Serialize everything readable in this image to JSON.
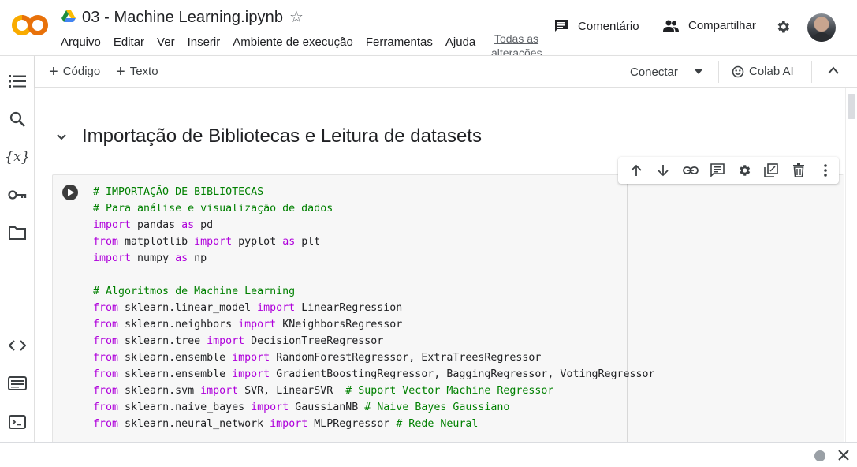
{
  "header": {
    "logo_text": "CO",
    "notebook_title": "03 - Machine Learning.ipynb",
    "menu": [
      "Arquivo",
      "Editar",
      "Ver",
      "Inserir",
      "Ambiente de execução",
      "Ferramentas",
      "Ajuda"
    ],
    "changes_link": "Todas as alterações",
    "comment_label": "Comentário",
    "share_label": "Compartilhar"
  },
  "toolbar": {
    "add_code_label": "Código",
    "add_text_label": "Texto",
    "connect_label": "Conectar",
    "colab_ai_label": "Colab AI"
  },
  "section": {
    "title": "Importação de Bibliotecas e Leitura de datasets"
  },
  "cell": {
    "code_lines": [
      [
        {
          "t": "# IMPORTAÇÃO DE BIBLIOTECAS",
          "c": "cm"
        }
      ],
      [
        {
          "t": "# Para análise e visualização de dados",
          "c": "cm"
        }
      ],
      [
        {
          "t": "import",
          "c": "kw"
        },
        {
          "t": " pandas ",
          "c": ""
        },
        {
          "t": "as",
          "c": "kw"
        },
        {
          "t": " pd",
          "c": ""
        }
      ],
      [
        {
          "t": "from",
          "c": "kw"
        },
        {
          "t": " matplotlib ",
          "c": ""
        },
        {
          "t": "import",
          "c": "kw"
        },
        {
          "t": " pyplot ",
          "c": ""
        },
        {
          "t": "as",
          "c": "kw"
        },
        {
          "t": " plt",
          "c": ""
        }
      ],
      [
        {
          "t": "import",
          "c": "kw"
        },
        {
          "t": " numpy ",
          "c": ""
        },
        {
          "t": "as",
          "c": "kw"
        },
        {
          "t": " np",
          "c": ""
        }
      ],
      [],
      [
        {
          "t": "# Algoritmos de Machine Learning",
          "c": "cm"
        }
      ],
      [
        {
          "t": "from",
          "c": "kw"
        },
        {
          "t": " sklearn.linear_model ",
          "c": ""
        },
        {
          "t": "import",
          "c": "kw"
        },
        {
          "t": " LinearRegression",
          "c": ""
        }
      ],
      [
        {
          "t": "from",
          "c": "kw"
        },
        {
          "t": " sklearn.neighbors ",
          "c": ""
        },
        {
          "t": "import",
          "c": "kw"
        },
        {
          "t": " KNeighborsRegressor",
          "c": ""
        }
      ],
      [
        {
          "t": "from",
          "c": "kw"
        },
        {
          "t": " sklearn.tree ",
          "c": ""
        },
        {
          "t": "import",
          "c": "kw"
        },
        {
          "t": " DecisionTreeRegressor",
          "c": ""
        }
      ],
      [
        {
          "t": "from",
          "c": "kw"
        },
        {
          "t": " sklearn.ensemble ",
          "c": ""
        },
        {
          "t": "import",
          "c": "kw"
        },
        {
          "t": " RandomForestRegressor, ExtraTreesRegressor",
          "c": ""
        }
      ],
      [
        {
          "t": "from",
          "c": "kw"
        },
        {
          "t": " sklearn.ensemble ",
          "c": ""
        },
        {
          "t": "import",
          "c": "kw"
        },
        {
          "t": " GradientBoostingRegressor, BaggingRegressor, VotingRegressor",
          "c": ""
        }
      ],
      [
        {
          "t": "from",
          "c": "kw"
        },
        {
          "t": " sklearn.svm ",
          "c": ""
        },
        {
          "t": "import",
          "c": "kw"
        },
        {
          "t": " SVR, LinearSVR  ",
          "c": ""
        },
        {
          "t": "# Suport Vector Machine Regressor",
          "c": "cm"
        }
      ],
      [
        {
          "t": "from",
          "c": "kw"
        },
        {
          "t": " sklearn.naive_bayes ",
          "c": ""
        },
        {
          "t": "import",
          "c": "kw"
        },
        {
          "t": " GaussianNB ",
          "c": ""
        },
        {
          "t": "# Naive Bayes Gaussiano",
          "c": "cm"
        }
      ],
      [
        {
          "t": "from",
          "c": "kw"
        },
        {
          "t": " sklearn.neural_network ",
          "c": ""
        },
        {
          "t": "import",
          "c": "kw"
        },
        {
          "t": " MLPRegressor ",
          "c": ""
        },
        {
          "t": "# Rede Neural",
          "c": "cm"
        }
      ]
    ]
  },
  "cell_toolbar_icons": [
    "arrow-up-icon",
    "arrow-down-icon",
    "link-icon",
    "comment-icon",
    "gear-icon",
    "mirror-cell-icon",
    "delete-icon",
    "more-vert-icon"
  ],
  "rail_icons": [
    "table-of-contents-icon",
    "search-icon",
    "variables-icon",
    "key-icon",
    "folder-icon",
    "code-snippets-icon",
    "command-palette-icon",
    "terminal-icon"
  ],
  "colors": {
    "accent_orange": "#f9ab00",
    "accent_orange_dark": "#e8710a",
    "comment_green": "#008000",
    "keyword_purple": "#af00db",
    "status_dot": "#9aa0a6"
  }
}
